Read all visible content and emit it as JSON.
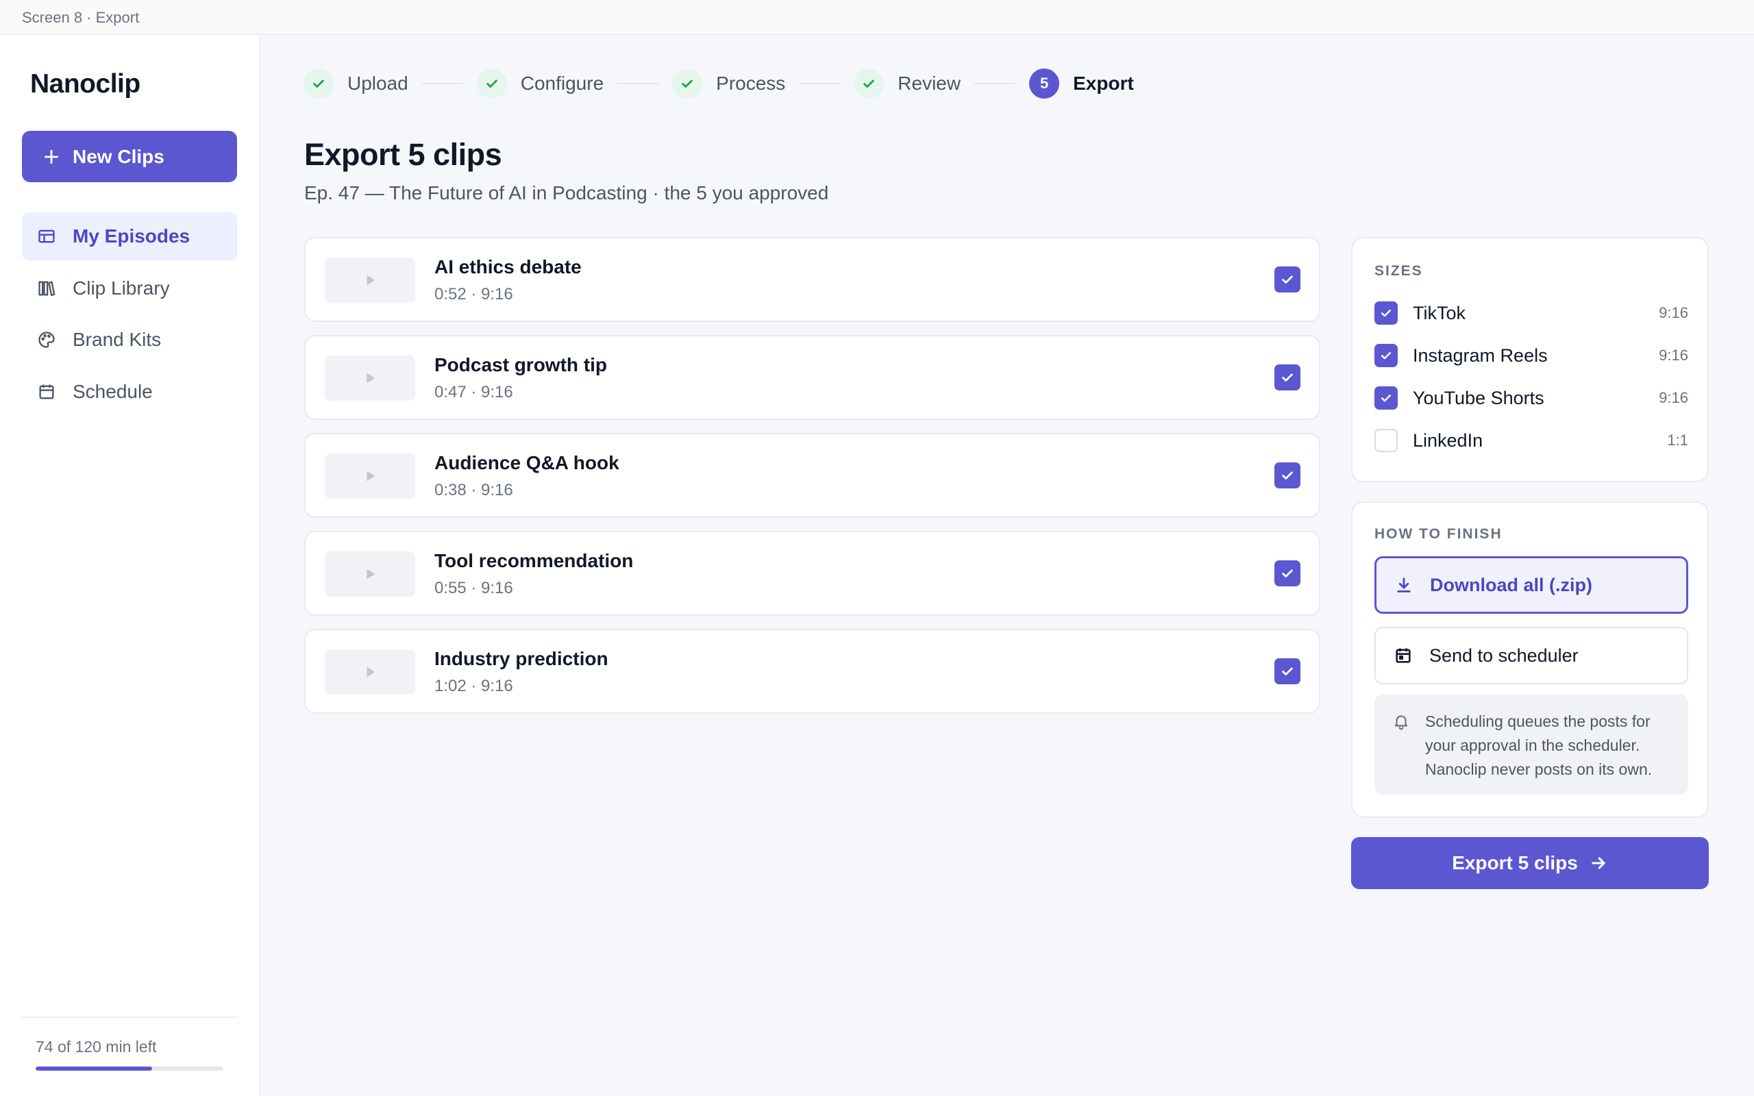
{
  "window": {
    "title": "Screen 8 · Export"
  },
  "sidebar": {
    "logo": "Nanoclip",
    "new_button": "New Clips",
    "items": [
      {
        "label": "My Episodes",
        "icon": "episodes-icon",
        "active": true
      },
      {
        "label": "Clip Library",
        "icon": "library-icon",
        "active": false
      },
      {
        "label": "Brand Kits",
        "icon": "palette-icon",
        "active": false
      },
      {
        "label": "Schedule",
        "icon": "calendar-icon",
        "active": false
      }
    ],
    "usage": {
      "text": "74 of 120 min left",
      "fraction": 0.62
    }
  },
  "stepper": {
    "steps": [
      {
        "label": "Upload",
        "status": "done"
      },
      {
        "label": "Configure",
        "status": "done"
      },
      {
        "label": "Process",
        "status": "done"
      },
      {
        "label": "Review",
        "status": "done"
      },
      {
        "label": "Export",
        "status": "current",
        "number": "5"
      }
    ]
  },
  "main": {
    "title": "Export 5 clips",
    "subtitle": "Ep. 47 — The Future of AI in Podcasting · the 5 you approved",
    "clips": [
      {
        "title": "AI ethics debate",
        "meta": "0:52 · 9:16",
        "checked": true
      },
      {
        "title": "Podcast growth tip",
        "meta": "0:47 · 9:16",
        "checked": true
      },
      {
        "title": "Audience Q&A hook",
        "meta": "0:38 · 9:16",
        "checked": true
      },
      {
        "title": "Tool recommendation",
        "meta": "0:55 · 9:16",
        "checked": true
      },
      {
        "title": "Industry prediction",
        "meta": "1:02 · 9:16",
        "checked": true
      }
    ]
  },
  "sizes": {
    "heading": "SIZES",
    "items": [
      {
        "name": "TikTok",
        "ratio": "9:16",
        "checked": true
      },
      {
        "name": "Instagram Reels",
        "ratio": "9:16",
        "checked": true
      },
      {
        "name": "YouTube Shorts",
        "ratio": "9:16",
        "checked": true
      },
      {
        "name": "LinkedIn",
        "ratio": "1:1",
        "checked": false
      }
    ]
  },
  "finish": {
    "heading": "HOW TO FINISH",
    "download_label": "Download all (.zip)",
    "scheduler_label": "Send to scheduler",
    "note": "Scheduling queues the posts for your approval in the scheduler. Nanoclip never posts on its own."
  },
  "export_button": "Export 5 clips",
  "colors": {
    "accent": "#5b57d1",
    "success": "#16a34a",
    "background": "#f6f7fb"
  }
}
